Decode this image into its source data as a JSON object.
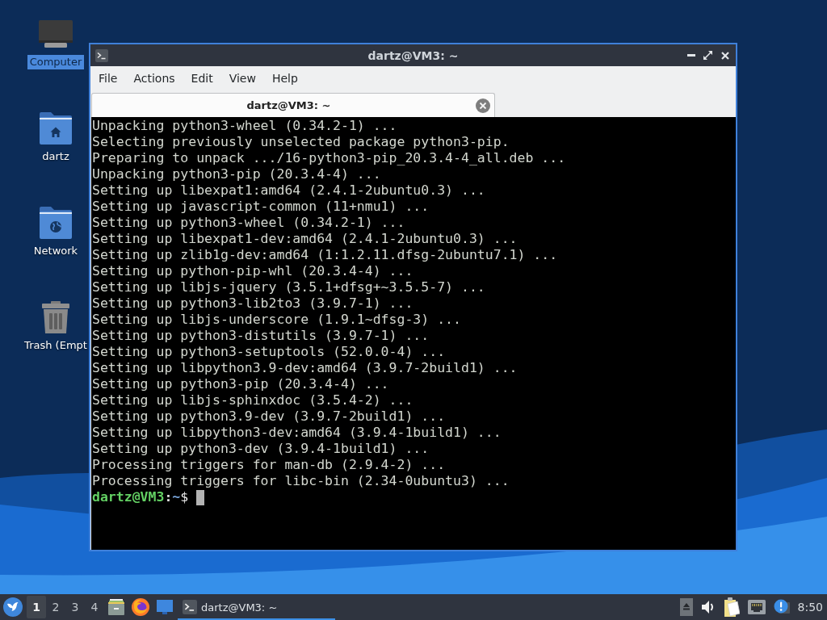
{
  "desktop": {
    "icons": [
      {
        "kind": "computer",
        "label": "Computer",
        "selected": true
      },
      {
        "kind": "home",
        "label": "dartz",
        "selected": false
      },
      {
        "kind": "network",
        "label": "Network",
        "selected": false
      },
      {
        "kind": "trash",
        "label": "Trash (Empt",
        "selected": false
      }
    ]
  },
  "window": {
    "title": "dartz@VM3: ~",
    "menu": [
      "File",
      "Actions",
      "Edit",
      "View",
      "Help"
    ],
    "tabs": [
      {
        "label": "dartz@VM3: ~",
        "selected": true
      }
    ],
    "terminal": {
      "lines": [
        "Unpacking python3-wheel (0.34.2-1) ...",
        "Selecting previously unselected package python3-pip.",
        "Preparing to unpack .../16-python3-pip_20.3.4-4_all.deb ...",
        "Unpacking python3-pip (20.3.4-4) ...",
        "Setting up libexpat1:amd64 (2.4.1-2ubuntu0.3) ...",
        "Setting up javascript-common (11+nmu1) ...",
        "Setting up python3-wheel (0.34.2-1) ...",
        "Setting up libexpat1-dev:amd64 (2.4.1-2ubuntu0.3) ...",
        "Setting up zlib1g-dev:amd64 (1:1.2.11.dfsg-2ubuntu7.1) ...",
        "Setting up python-pip-whl (20.3.4-4) ...",
        "Setting up libjs-jquery (3.5.1+dfsg+~3.5.5-7) ...",
        "Setting up python3-lib2to3 (3.9.7-1) ...",
        "Setting up libjs-underscore (1.9.1~dfsg-3) ...",
        "Setting up python3-distutils (3.9.7-1) ...",
        "Setting up python3-setuptools (52.0.0-4) ...",
        "Setting up libpython3.9-dev:amd64 (3.9.7-2build1) ...",
        "Setting up python3-pip (20.3.4-4) ...",
        "Setting up libjs-sphinxdoc (3.5.4-2) ...",
        "Setting up python3.9-dev (3.9.7-2build1) ...",
        "Setting up libpython3-dev:amd64 (3.9.4-1build1) ...",
        "Setting up python3-dev (3.9.4-1build1) ...",
        "Processing triggers for man-db (2.9.4-2) ...",
        "Processing triggers for libc-bin (2.34-0ubuntu3) ..."
      ],
      "prompt": {
        "user_host": "dartz@VM3",
        "separator": ":",
        "path": "~",
        "symbol": "$"
      }
    }
  },
  "taskbar": {
    "workspaces": [
      {
        "label": "1",
        "selected": true
      },
      {
        "label": "2",
        "selected": false
      },
      {
        "label": "3",
        "selected": false
      },
      {
        "label": "4",
        "selected": false
      }
    ],
    "launchers": [
      {
        "kind": "file-manager"
      },
      {
        "kind": "browser"
      },
      {
        "kind": "display"
      }
    ],
    "tasks": [
      {
        "label": "dartz@VM3: ~",
        "selected": true
      }
    ],
    "tray": [
      {
        "kind": "eject"
      },
      {
        "kind": "volume"
      },
      {
        "kind": "clipboard"
      },
      {
        "kind": "network"
      },
      {
        "kind": "notification"
      }
    ],
    "clock": "8:50"
  }
}
